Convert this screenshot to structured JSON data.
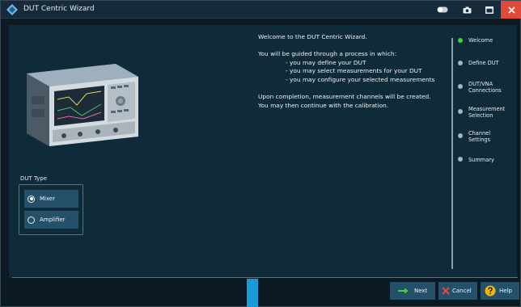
{
  "window": {
    "title": "DUT Centric Wizard"
  },
  "welcome": {
    "heading": "Welcome to the DUT Centric Wizard.",
    "intro": "You will be guided through a process in which:",
    "items": [
      "- you may define your DUT",
      "- you may select measurements for your DUT",
      "- you may configure your selected measurements"
    ],
    "completion_1": "Upon completion, measurement channels will be created.",
    "completion_2": "You may then continue with the calibration."
  },
  "dut_type": {
    "label": "DUT Type",
    "options": [
      "Mixer",
      "Amplifier"
    ],
    "selected": "Mixer"
  },
  "steps": [
    {
      "label_1": "Welcome",
      "label_2": "",
      "active": true
    },
    {
      "label_1": "Define DUT",
      "label_2": "",
      "active": false
    },
    {
      "label_1": "DUT/VNA",
      "label_2": "Connections",
      "active": false
    },
    {
      "label_1": "Measurement",
      "label_2": "Selection",
      "active": false
    },
    {
      "label_1": "Channel",
      "label_2": "Settings",
      "active": false
    },
    {
      "label_1": "Summary",
      "label_2": "",
      "active": false
    }
  ],
  "buttons": {
    "next": "Next",
    "cancel": "Cancel",
    "help": "Help"
  },
  "colors": {
    "accent_green": "#3fd23a",
    "close_red": "#e04a3a",
    "progress_blue": "#1a9ad6",
    "help_yellow": "#f2b705",
    "button_bg": "#24506a"
  },
  "icons": {
    "title": "rs-logo-icon",
    "toggle": "toggle-icon",
    "camera": "camera-icon",
    "maximize": "maximize-icon",
    "close": "close-icon",
    "next": "arrow-right-icon",
    "cancel": "cancel-x-icon",
    "help": "help-icon"
  }
}
